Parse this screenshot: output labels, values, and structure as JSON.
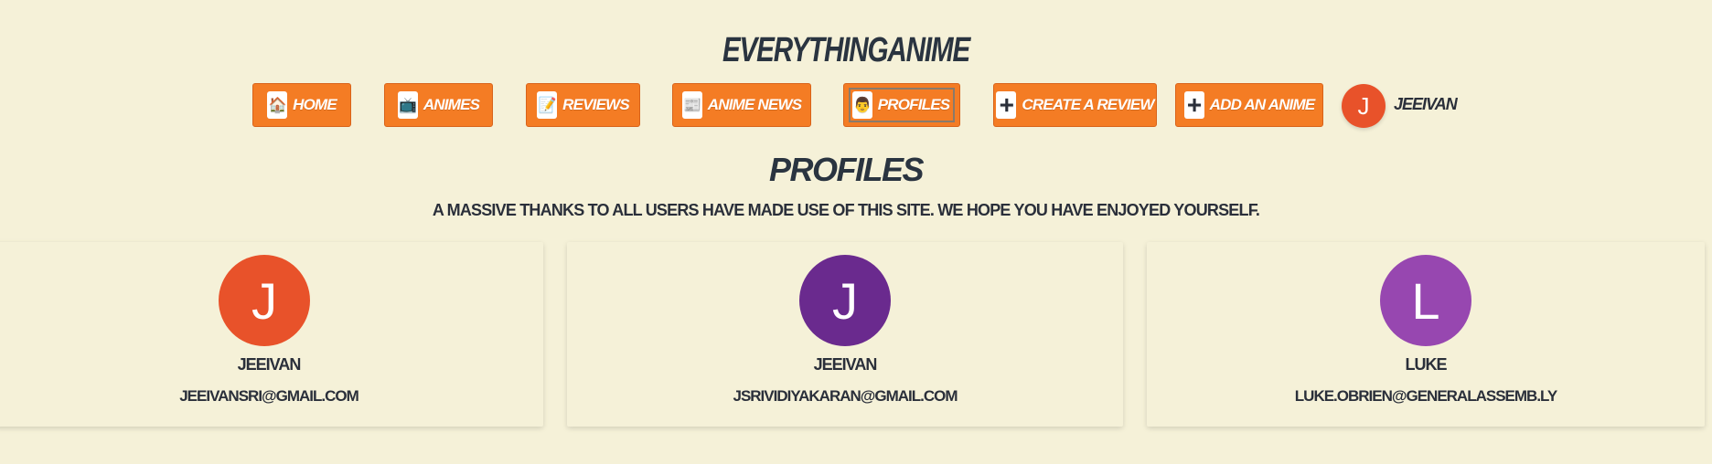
{
  "site": {
    "title": "EVERYTHINGANIME"
  },
  "nav": {
    "items": [
      {
        "label": "HOME",
        "icon": "house-icon",
        "glyph": "🏠"
      },
      {
        "label": "ANIMES",
        "icon": "tv-icon",
        "glyph": "📺"
      },
      {
        "label": "REVIEWS",
        "icon": "memo-icon",
        "glyph": "📝"
      },
      {
        "label": "ANIME NEWS",
        "icon": "newspaper-icon",
        "glyph": "📰"
      },
      {
        "label": "PROFILES",
        "icon": "face-icon",
        "glyph": "👨"
      },
      {
        "label": "CREATE A REVIEW",
        "icon": "plus-icon",
        "glyph": "+"
      },
      {
        "label": "ADD AN ANIME",
        "icon": "plus-icon",
        "glyph": "+"
      }
    ],
    "active": "PROFILES",
    "user": {
      "initial": "J",
      "name": "JEEIVAN",
      "color": "#e8522a"
    }
  },
  "main": {
    "title": "PROFILES",
    "subtitle": "A MASSIVE THANKS TO ALL USERS HAVE MADE USE OF THIS SITE. WE HOPE YOU HAVE ENJOYED YOURSELF.",
    "profiles": [
      {
        "initial": "J",
        "name": "JEEIVAN",
        "email": "JEEIVANSRI@GMAIL.COM",
        "color": "#e8522a"
      },
      {
        "initial": "J",
        "name": "JEEIVAN",
        "email": "JSRIVIDIYAKARAN@GMAIL.COM",
        "color": "#6a2a8e"
      },
      {
        "initial": "L",
        "name": "LUKE",
        "email": "LUKE.OBRIEN@GENERALASSEMB.LY",
        "color": "#9747b0"
      }
    ]
  },
  "colors": {
    "background": "#f5f1d8",
    "accent": "#f47c24",
    "text": "#2a2f3a"
  }
}
